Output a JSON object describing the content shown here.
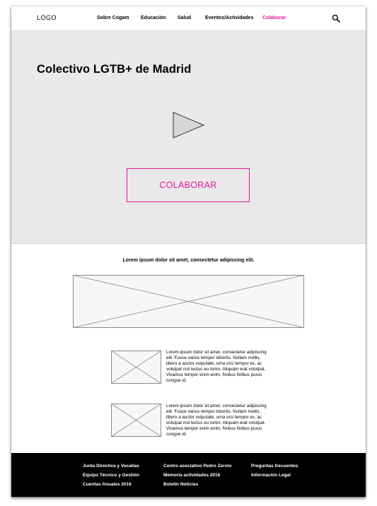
{
  "nav": {
    "logo": "LOGO",
    "items": [
      {
        "label": "Sobre Cogam"
      },
      {
        "label": "Educación"
      },
      {
        "label": "Salud"
      },
      {
        "label": "Eventos/Actividades"
      },
      {
        "label": "Colaborar",
        "active": true
      }
    ],
    "search_icon": "search-icon"
  },
  "hero": {
    "title": "Colectivo LGTB+ de Madrid",
    "play_icon": "play-icon",
    "cta_label": "COLABORAR"
  },
  "content": {
    "intro": "Lorem ipsum dolor sit amet, consectetur adipiscing elit.",
    "features": [
      {
        "text": "Lorem ipsum dolor sit amet, consectetur adipiscing elit. Fusce varius tempor lobortis. Nullam mollis, libero a auctor vulputate, urna orci tempor ex, ac volutpat nisl lectus eu tortor. Aliquam erat volutpat. Vivamus tempor enim enim, finibus finibus purus congue id."
      },
      {
        "text": "Lorem ipsum dolor sit amet, consectetur adipiscing elit. Fusce varius tempor lobortis. Nullam mollis, libero a auctor vulputate, urna orci tempor ex, ac volutpat nisl lectus eu tortor. Aliquam erat volutpat. Vivamus tempor enim enim, finibus finibus purus congue id."
      }
    ]
  },
  "footer": {
    "columns": [
      [
        "Junta Directiva y Vocalías",
        "Equipo Técnico y Gestión",
        "Cuentas Anuales 2016"
      ],
      [
        "Centro asociativo Pedro Zerolo",
        "Memoria actividades 2016",
        "Boletín Noticias"
      ],
      [
        "Preguntas frecuentes",
        "Información Legal"
      ]
    ]
  },
  "colors": {
    "accent": "#e6199b",
    "hero_bg": "#e9e9e9",
    "footer_bg": "#000000"
  }
}
